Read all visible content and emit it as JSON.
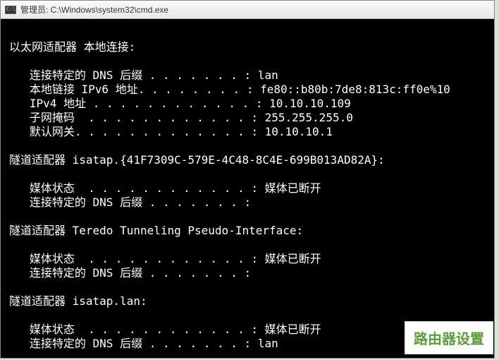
{
  "window": {
    "title": "管理员: C:\\Windows\\system32\\cmd.exe",
    "icon_label": "C:\\"
  },
  "terminal": {
    "lines": [
      "",
      "以太网适配器 本地连接:",
      "",
      "   连接特定的 DNS 后缀 . . . . . . . : lan",
      "   本地链接 IPv6 地址. . . . . . . . : fe80::b80b:7de8:813c:ff0e%10",
      "   IPv4 地址 . . . . . . . . . . . . : 10.10.10.109",
      "   子网掩码  . . . . . . . . . . . . : 255.255.255.0",
      "   默认网关. . . . . . . . . . . . . : 10.10.10.1",
      "",
      "隧道适配器 isatap.{41F7309C-579E-4C48-8C4E-699B013AD82A}:",
      "",
      "   媒体状态  . . . . . . . . . . . . : 媒体已断开",
      "   连接特定的 DNS 后缀 . . . . . . . :",
      "",
      "隧道适配器 Teredo Tunneling Pseudo-Interface:",
      "",
      "   媒体状态  . . . . . . . . . . . . : 媒体已断开",
      "   连接特定的 DNS 后缀 . . . . . . . :",
      "",
      "隧道适配器 isatap.lan:",
      "",
      "   媒体状态  . . . . . . . . . . . . : 媒体已断开",
      "   连接特定的 DNS 后缀 . . . . . . . : lan"
    ]
  },
  "badge": {
    "text": "路由器设置"
  }
}
